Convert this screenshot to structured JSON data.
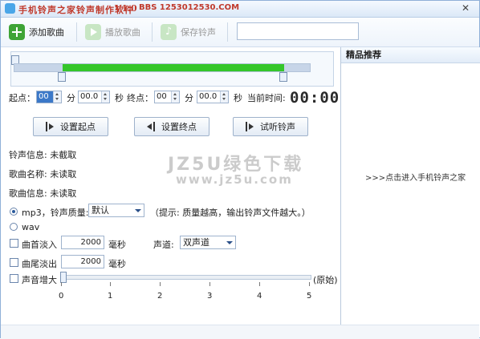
{
  "window": {
    "title": "手机铃声之家铃声制作软件",
    "version": "V1.0",
    "bbs": "BBS 1253012530.COM",
    "close_glyph": "✕"
  },
  "toolbar": {
    "add_song": "添加歌曲",
    "play_song": "播放歌曲",
    "save_ringtone": "保存铃声",
    "path_value": ""
  },
  "right_panel": {
    "header": "精品推荐",
    "link": ">>>点击进入手机铃声之家"
  },
  "time": {
    "start_label": "起点：",
    "end_label": "终点：",
    "min_label": "分",
    "sec_label": "秒",
    "start_min": "00",
    "start_sec": "00.0",
    "end_min": "00",
    "end_sec": "00.0",
    "current_label": "当前时间:",
    "current_time": "00:00"
  },
  "buttons": {
    "set_start": "设置起点",
    "set_end": "设置终点",
    "preview": "试听铃声"
  },
  "info": {
    "ringtone_info": "铃声信息: 未截取",
    "song_name": "歌曲名称: 未读取",
    "song_info": "歌曲信息: 未读取"
  },
  "format": {
    "mp3_label": "mp3，铃声质量:",
    "quality_value": "默认",
    "hint": "（提示: 质量越高，输出铃声文件越大。）",
    "wav_label": "wav",
    "selected": "mp3"
  },
  "effects": {
    "fade_in_label": "曲首淡入",
    "fade_in_value": "2000",
    "fade_out_label": "曲尾淡出",
    "fade_out_value": "2000",
    "ms_unit": "毫秒",
    "channel_label": "声道:",
    "channel_value": "双声道",
    "volume_label": "声音增大",
    "volume_suffix": "(原始)",
    "volume_level": 0,
    "volume_ticks": [
      "0",
      "1",
      "2",
      "3",
      "4",
      "5"
    ]
  },
  "watermark": {
    "brand": "JZ5U绿色下载",
    "url": "www.jz5u.com"
  },
  "colors": {
    "accent_green": "#35c62a",
    "title_red": "#c0392b"
  },
  "icons": {
    "add": "plus-icon",
    "play": "play-icon",
    "save": "music-note-icon"
  }
}
